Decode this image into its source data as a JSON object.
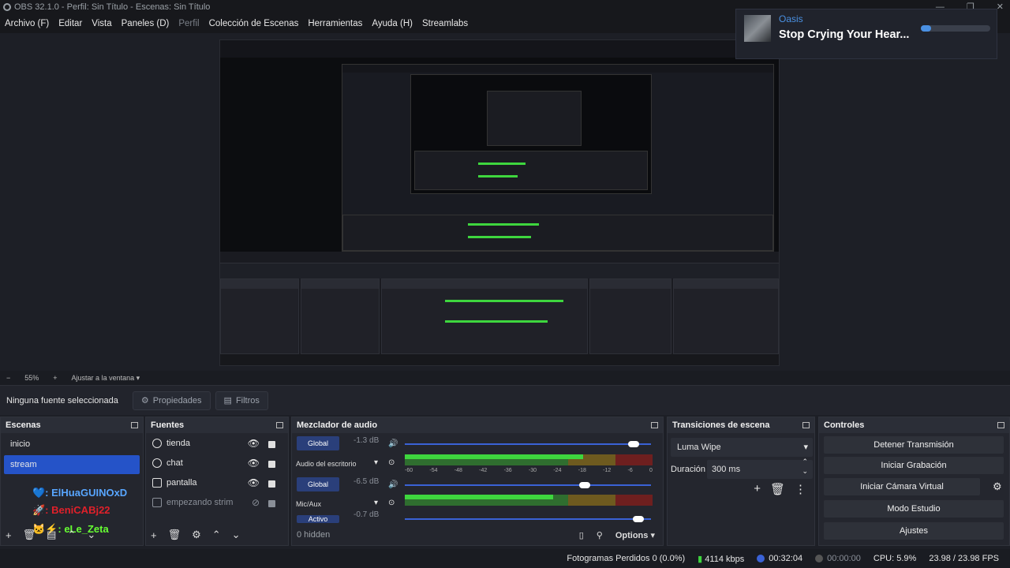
{
  "window": {
    "title": "OBS 32.1.0 - Perfil: Sin Título - Escenas: Sin Título"
  },
  "menu": [
    {
      "label": "Archivo (F)"
    },
    {
      "label": "Editar"
    },
    {
      "label": "Vista"
    },
    {
      "label": "Paneles (D)"
    },
    {
      "label": "Perfil",
      "disabled": true
    },
    {
      "label": "Colección de Escenas"
    },
    {
      "label": "Herramientas"
    },
    {
      "label": "Ayuda (H)"
    },
    {
      "label": "Streamlabs"
    }
  ],
  "notification": {
    "artist": "Oasis",
    "song": "Stop Crying Your Hear...",
    "progress": 0.15,
    "accent": "#4a90e2"
  },
  "preview_toolbar": {
    "minus": "−",
    "zoom": "55%",
    "plus": "+",
    "fit": "Ajustar a la ventana"
  },
  "properties_bar": {
    "no_selection": "Ninguna fuente seleccionada",
    "properties": "Propiedades",
    "filters": "Filtros"
  },
  "scenes": {
    "title": "Escenas",
    "items": [
      {
        "label": "inicio"
      },
      {
        "label": "stream",
        "selected": true
      }
    ],
    "chat": [
      {
        "text": "💙: ElHuaGUINOxD",
        "color": "#58a6ff"
      },
      {
        "text": "🚀: BeniCABj22",
        "color": "#e0202a"
      },
      {
        "text": "🐱⚡: eLe_Zeta",
        "color": "#66ff33"
      }
    ]
  },
  "sources": {
    "title": "Fuentes",
    "items": [
      {
        "label": "tienda",
        "icon": "browser-icon"
      },
      {
        "label": "chat",
        "icon": "browser-icon"
      },
      {
        "label": "pantalla",
        "icon": "display-icon"
      },
      {
        "label": "empezando strim",
        "icon": "image-icon",
        "hidden": true
      }
    ]
  },
  "mixer": {
    "title": "Mezclador de audio",
    "tracks": [
      {
        "button": "Global",
        "db": "-1.3 dB",
        "label": "Audio del escritorio",
        "volume": 0.93,
        "level": 0.72
      },
      {
        "button": "Global",
        "db": "-6.5 dB",
        "label": "Mic/Aux",
        "volume": 0.73,
        "level": 0.6
      },
      {
        "button": "Activo",
        "db": "-0.7 dB",
        "label": "",
        "volume": 0.95,
        "level": 0
      }
    ],
    "ticks": [
      "-60",
      "-54",
      "-48",
      "-42",
      "-36",
      "-30",
      "-24",
      "-18",
      "-12",
      "-6",
      "0"
    ],
    "hidden": "0 hidden",
    "options": "Options"
  },
  "transitions": {
    "title": "Transiciones de escena",
    "selected": "Luma Wipe",
    "duration_label": "Duración",
    "duration_value": "300 ms"
  },
  "controls": {
    "title": "Controles",
    "buttons": [
      "Detener Transmisión",
      "Iniciar Grabación",
      "Iniciar Cámara Virtual",
      "Modo Estudio",
      "Ajustes"
    ]
  },
  "status": {
    "dropped": "Fotogramas Perdidos 0 (0.0%)",
    "bitrate": "4114 kbps",
    "stream_time": "00:32:04",
    "rec_time": "00:00:00",
    "cpu": "CPU: 5.9%",
    "fps": "23.98 / 23.98 FPS"
  }
}
